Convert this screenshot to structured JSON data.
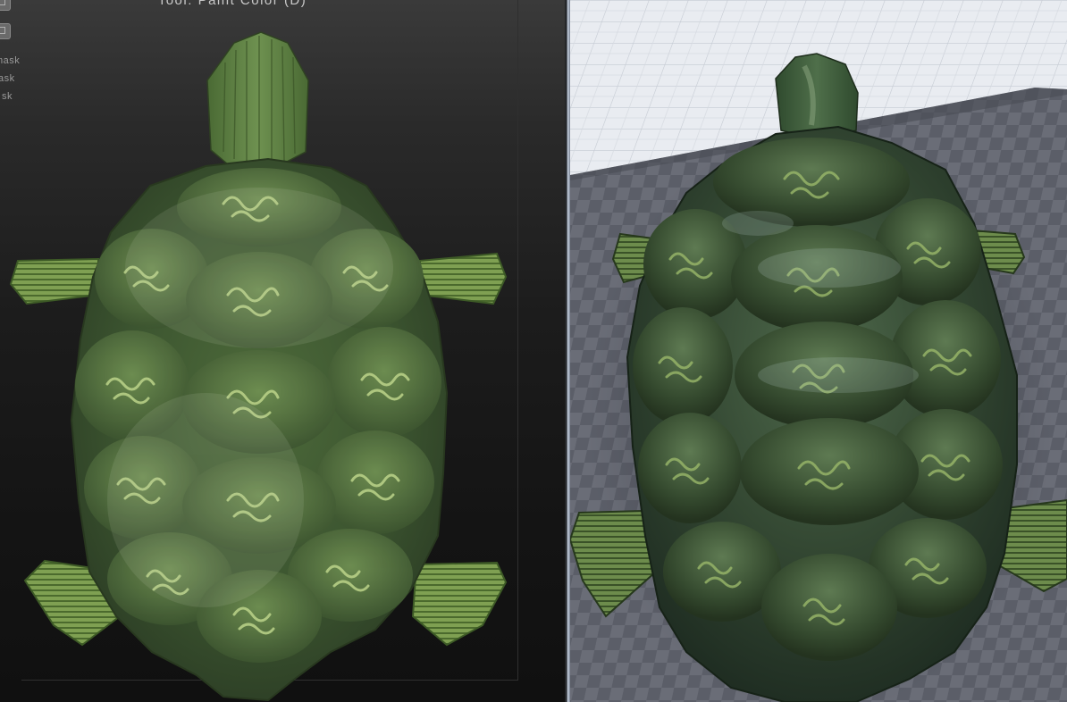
{
  "left_viewport": {
    "tool_title": "Tool: Paint Color (D)",
    "mask_labels": [
      "mask",
      "ask",
      "sk"
    ]
  },
  "right_viewport": {
    "scene": "engine-preview"
  },
  "colors": {
    "shell_base": "#34492a",
    "shell_light": "#8aa862",
    "pattern": "#b6cf84",
    "grid_floor": "#5a5d66",
    "sky_grid": "#e6e9ef"
  }
}
